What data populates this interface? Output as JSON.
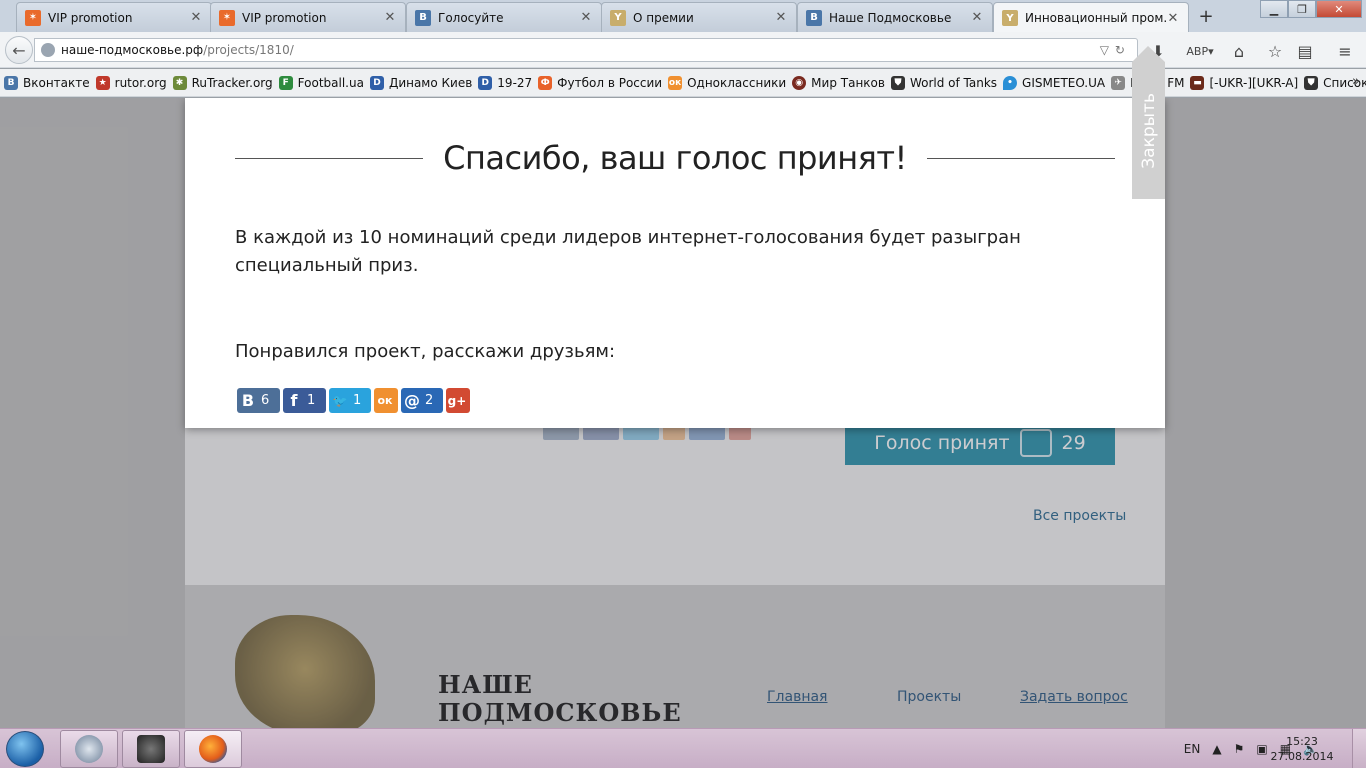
{
  "browser": {
    "tabs": [
      {
        "title": "VIP promotion",
        "icon": "vip-icon"
      },
      {
        "title": "VIP promotion",
        "icon": "vip-icon"
      },
      {
        "title": "Голосуйте",
        "icon": "vk-icon"
      },
      {
        "title": "О премии",
        "icon": "award-icon"
      },
      {
        "title": "Наше Подмосковье",
        "icon": "vk-icon"
      },
      {
        "title": "Инновационный пром...",
        "icon": "award-icon",
        "active": true
      }
    ],
    "url_host": "наше-подмосковье.рф",
    "url_path": "/projects/1810/",
    "bookmarks": [
      "Вконтакте",
      "rutor.org",
      "RuTracker.org",
      "Football.ua",
      "Динамо  Киев",
      "19-27",
      "Футбол в России",
      "Одноклассники",
      "Мир Танков",
      "World of Tanks",
      "GISMETEO.UA",
      "ROKS FM",
      "[-UKR-][UKR-A]",
      "Список боёв"
    ]
  },
  "page": {
    "vote_button_label": "Голос принят",
    "vote_count": "29",
    "all_projects_link": "Все проекты",
    "footer_brand_line1": "НАШЕ",
    "footer_brand_line2": "ПОДМОСКОВЬЕ",
    "footer_links": [
      "Главная",
      "Проекты",
      "Задать вопрос"
    ]
  },
  "modal": {
    "title": "Спасибо, ваш голос принят!",
    "text": "В каждой из 10 номинаций среди лидеров интернет-голосования будет разыгран специальный приз.",
    "share_label": "Понравился проект, расскажи друзьям:",
    "close_label": "Закрыть",
    "shares": [
      {
        "network": "vk",
        "symbol": "В",
        "count": "6"
      },
      {
        "network": "facebook",
        "symbol": "f",
        "count": "1"
      },
      {
        "network": "twitter",
        "symbol": "🐦",
        "count": "1"
      },
      {
        "network": "odnoklassniki",
        "symbol": "ок",
        "count": ""
      },
      {
        "network": "mail",
        "symbol": "@",
        "count": "2"
      },
      {
        "network": "google-plus",
        "symbol": "g+",
        "count": ""
      }
    ]
  },
  "taskbar": {
    "language": "EN",
    "time": "15:23",
    "date": "27.08.2014"
  }
}
